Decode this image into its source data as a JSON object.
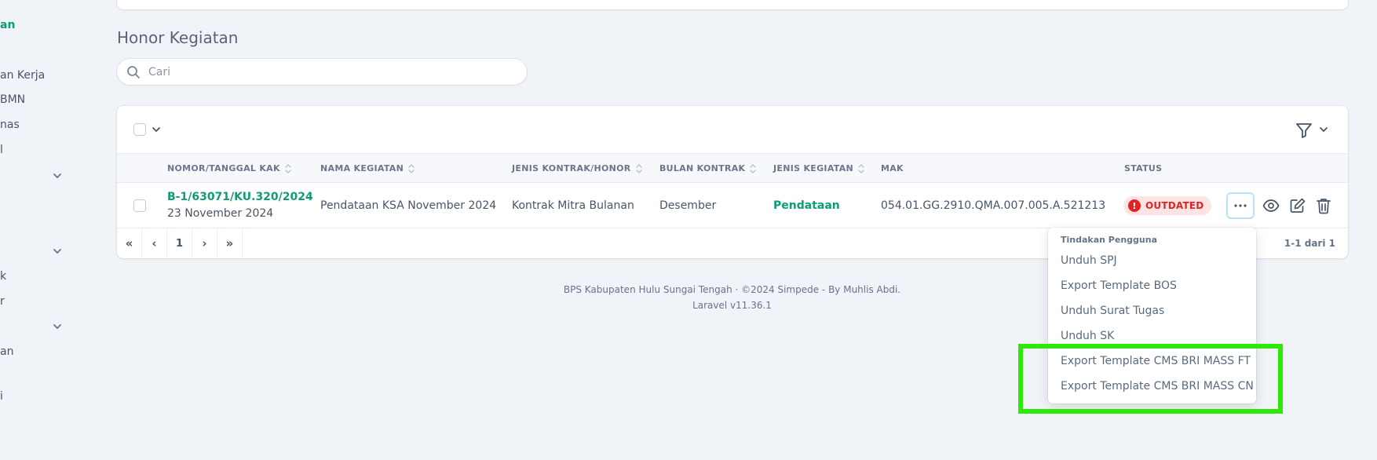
{
  "sidebar": {
    "items": [
      {
        "label": "an",
        "active": true
      },
      {
        "label": "an Kerja"
      },
      {
        "label": "BMN"
      },
      {
        "label": "nas"
      },
      {
        "label": "l"
      },
      {
        "label": "k"
      },
      {
        "label": "r"
      },
      {
        "label": "an"
      },
      {
        "label": "i"
      }
    ]
  },
  "page": {
    "title": "Honor Kegiatan"
  },
  "search": {
    "placeholder": "Cari",
    "value": ""
  },
  "table": {
    "columns": [
      "NOMOR/TANGGAL KAK",
      "NAMA KEGIATAN",
      "JENIS KONTRAK/HONOR",
      "BULAN KONTRAK",
      "JENIS KEGIATAN",
      "MAK",
      "STATUS"
    ],
    "rows": [
      {
        "nomor": "B-1/63071/KU.320/2024",
        "tanggal": "23 November 2024",
        "nama": "Pendataan KSA November 2024",
        "jenis_kontrak": "Kontrak Mitra Bulanan",
        "bulan": "Desember",
        "jenis_kegiatan": "Pendataan",
        "mak": "054.01.GG.2910.QMA.007.005.A.521213",
        "status": "OUTDATED"
      }
    ],
    "pager": {
      "first": "«",
      "prev": "‹",
      "page": "1",
      "next": "›",
      "last": "»",
      "range": "1-1 dari 1"
    }
  },
  "footer": {
    "line1": "BPS Kabupaten Hulu Sungai Tengah · ©2024 Simpede - By Muhlis Abdi.",
    "line2": "Laravel v11.36.1"
  },
  "dropdown": {
    "header": "Tindakan Pengguna",
    "items": [
      "Unduh SPJ",
      "Export Template BOS",
      "Unduh Surat Tugas",
      "Unduh SK",
      "Export Template CMS BRI MASS FT",
      "Export Template CMS BRI MASS CN"
    ]
  },
  "colors": {
    "accent": "#0d9c77",
    "danger": "#dc2626",
    "highlight": "#2ee80a"
  }
}
